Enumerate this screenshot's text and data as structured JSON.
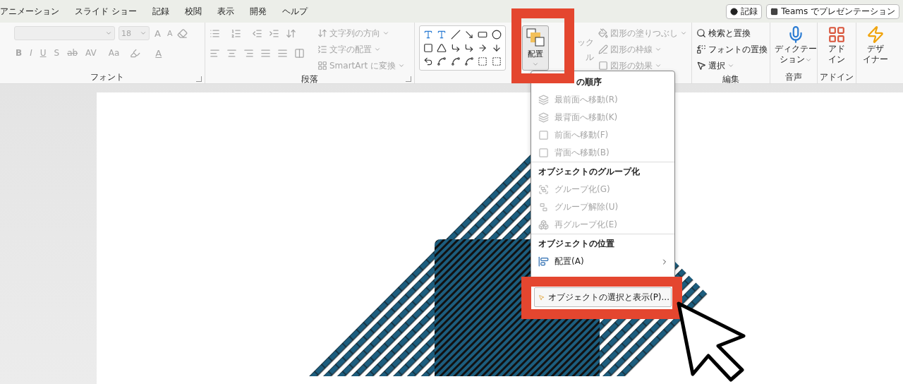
{
  "tabs": [
    "アニメーション",
    "スライド ショー",
    "記録",
    "校閲",
    "表示",
    "開発",
    "ヘルプ"
  ],
  "header_buttons": [
    {
      "kind": "record",
      "label": "記録"
    },
    {
      "kind": "teams",
      "label": "Teams でプレゼンテーション"
    }
  ],
  "font_group": {
    "label": "フォント",
    "font_size": "18",
    "grow": "A",
    "shrink": "A",
    "format_buttons": [
      "B",
      "I",
      "U",
      "S",
      "ab",
      "AV",
      "Aa"
    ],
    "font_color": "A"
  },
  "paragraph_group": {
    "label": "段落",
    "commands": [
      {
        "label": "文字列の方向",
        "disabled": true
      },
      {
        "label": "文字の配置",
        "disabled": true
      },
      {
        "label": "SmartArt に変換",
        "disabled": true
      }
    ]
  },
  "drawing_group": {
    "arrange_button": "配置",
    "quick_style": [
      "ック",
      "ル"
    ],
    "commands": [
      {
        "label": "図形の塗りつぶし",
        "disabled": true
      },
      {
        "label": "図形の枠線",
        "disabled": true
      },
      {
        "label": "図形の効果",
        "disabled": true
      }
    ]
  },
  "editing_group": {
    "label": "編集",
    "commands": [
      {
        "kind": "find",
        "label": "検索と置換",
        "dropdown": false
      },
      {
        "kind": "replace-font",
        "label": "フォントの置換",
        "dropdown": false
      },
      {
        "kind": "select",
        "label": "選択",
        "dropdown": true
      }
    ]
  },
  "large_groups": [
    {
      "kind": "dictation",
      "button": [
        "ディクテー",
        "ション"
      ],
      "dropdown": true,
      "label": "音声"
    },
    {
      "kind": "addins",
      "button": [
        "アド",
        "イン"
      ],
      "dropdown": false,
      "label": "アドイン"
    },
    {
      "kind": "designer",
      "button": [
        "デザ",
        "イナー"
      ],
      "dropdown": false
    }
  ],
  "arrange_menu": [
    {
      "kind": "header",
      "label": "の順序"
    },
    {
      "kind": "item",
      "label": "最前面へ移動(R)",
      "disabled": true,
      "selected": false,
      "submenu": false
    },
    {
      "kind": "item",
      "label": "最背面へ移動(K)",
      "disabled": true,
      "selected": false,
      "submenu": false
    },
    {
      "kind": "item",
      "label": "前面へ移動(F)",
      "disabled": true,
      "selected": false,
      "submenu": false
    },
    {
      "kind": "item",
      "label": "背面へ移動(B)",
      "disabled": true,
      "selected": false,
      "submenu": false
    },
    {
      "kind": "header",
      "label": "オブジェクトのグループ化"
    },
    {
      "kind": "item",
      "label": "グループ化(G)",
      "disabled": true,
      "selected": false,
      "submenu": false
    },
    {
      "kind": "item",
      "label": "グループ解除(U)",
      "disabled": true,
      "selected": false,
      "submenu": false
    },
    {
      "kind": "item",
      "label": "再グループ化(E)",
      "disabled": true,
      "selected": false,
      "submenu": false
    },
    {
      "kind": "header",
      "label": "オブジェクトの位置"
    },
    {
      "kind": "item",
      "label": "配置(A)",
      "disabled": false,
      "selected": false,
      "submenu": true
    },
    {
      "kind": "item",
      "label": "オブジェクトの選択と表示(P)...",
      "disabled": false,
      "selected": true,
      "submenu": false
    }
  ]
}
